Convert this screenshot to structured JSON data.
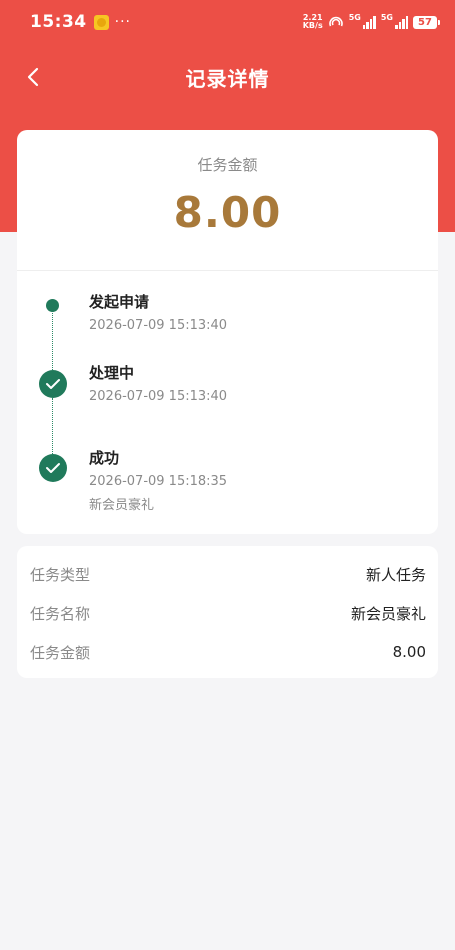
{
  "status_bar": {
    "time": "15:34",
    "dots": "···",
    "speed_value": "2.21",
    "speed_unit": "KB/s",
    "net1": "5G",
    "net2": "5G",
    "battery": "57"
  },
  "nav": {
    "title": "记录详情",
    "back_icon": "chevron-left-icon"
  },
  "amount": {
    "label": "任务金额",
    "value": "8.00"
  },
  "timeline": [
    {
      "title": "发起申请",
      "time": "2026-07-09 15:13:40",
      "state": "started"
    },
    {
      "title": "处理中",
      "time": "2026-07-09 15:13:40",
      "state": "done"
    },
    {
      "title": "成功",
      "time": "2026-07-09 15:18:35",
      "note": "新会员豪礼",
      "state": "done"
    }
  ],
  "details": [
    {
      "label": "任务类型",
      "value": "新人任务"
    },
    {
      "label": "任务名称",
      "value": "新会员豪礼"
    },
    {
      "label": "任务金额",
      "value": "8.00"
    }
  ],
  "colors": {
    "header": "#ec4f46",
    "amount": "#a8793a",
    "timeline": "#207a5b",
    "background": "#f5f5f7"
  }
}
